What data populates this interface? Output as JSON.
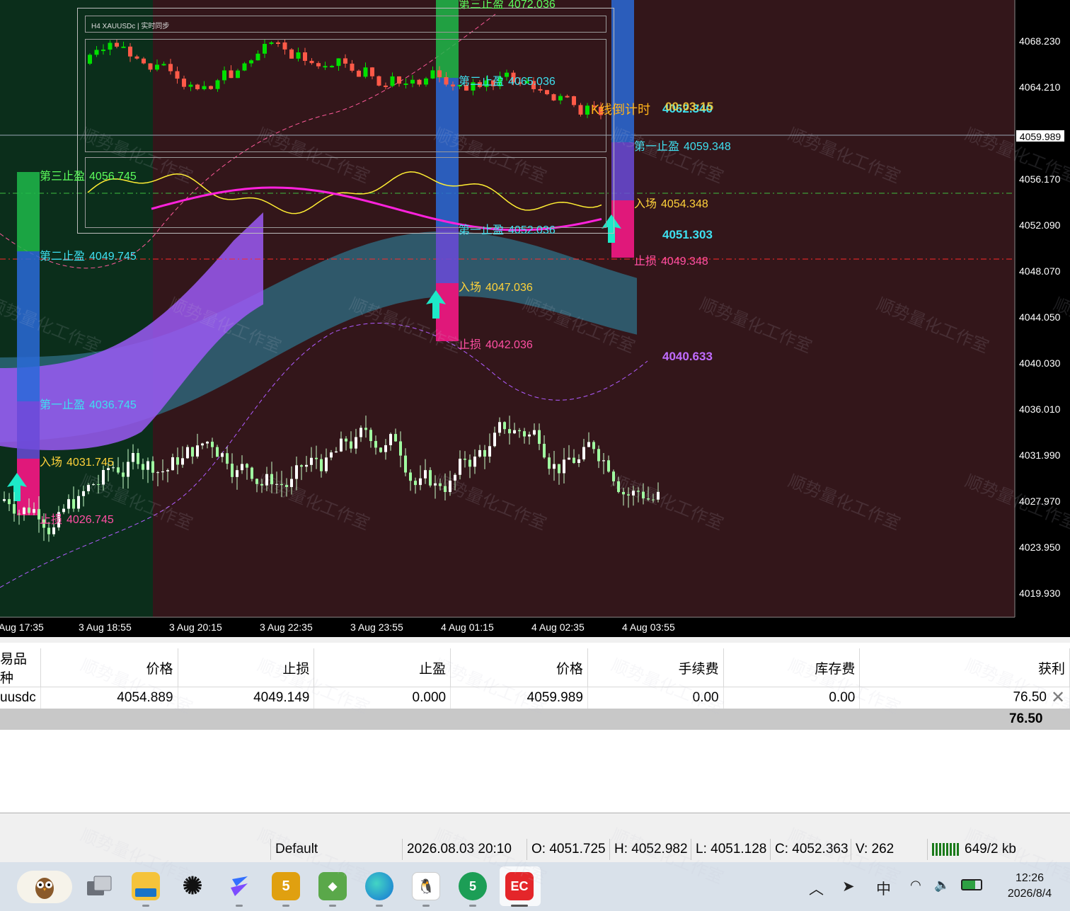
{
  "chart": {
    "mini_title": "H4  XAUUSDc  |  实时同步",
    "countdown_label": "K线倒计时",
    "countdown_value": "00:03:15",
    "overlap_price": "4062.340",
    "current_price": "4059.989",
    "price_axis": [
      "4068.230",
      "4064.210",
      "4056.170",
      "4052.090",
      "4048.070",
      "4044.050",
      "4040.030",
      "4036.010",
      "4031.990",
      "4027.970",
      "4023.950",
      "4019.930"
    ],
    "time_axis": [
      "Aug 17:35",
      "3 Aug 18:55",
      "3 Aug 20:15",
      "3 Aug 22:35",
      "3 Aug 23:55",
      "4 Aug 01:15",
      "4 Aug 02:35",
      "4 Aug 03:55"
    ],
    "signal_blocks": [
      {
        "tp3_label": "第三止盈",
        "tp3": "4056.745",
        "tp2_label": "第二止盈",
        "tp2": "4049.745",
        "tp1_label": "第一止盈",
        "tp1": "4036.745",
        "entry_label": "入场",
        "entry": "4031.745",
        "sl_label": "止损",
        "sl": "4026.745"
      },
      {
        "tp3_label": "第三止盈",
        "tp3": "4072.036",
        "tp2_label": "第二止盈",
        "tp2": "4065.036",
        "tp1_label": "第一止盈",
        "tp1": "4052.036",
        "entry_label": "入场",
        "entry": "4047.036",
        "sl_label": "止损",
        "sl": "4042.036"
      },
      {
        "tp1_label": "第一止盈",
        "tp1": "4059.348",
        "entry_label": "入场",
        "entry": "4054.348",
        "sl_label": "止损",
        "sl": "4049.348"
      }
    ],
    "band_upper": "4051.303",
    "band_lower": "4040.633",
    "watermark": "顺势量化工作室",
    "colors": {
      "background_dark": "#33161a",
      "green_zone": "#0b2e1b",
      "bull_candle": "#00e000",
      "bear_candle": "#ff5a48",
      "tp_text": "#3ee0f0",
      "entry_text": "#ffd23a",
      "sl_text": "#ff4fa3",
      "purple_band": "#9b59f5"
    }
  },
  "trades": {
    "headers": [
      "易品种",
      "价格",
      "止损",
      "止盈",
      "价格",
      "手续费",
      "库存费",
      "获利"
    ],
    "row": {
      "symbol": "uusdc",
      "open_price": "4054.889",
      "sl": "4049.149",
      "tp": "0.000",
      "price": "4059.989",
      "commission": "0.00",
      "swap": "0.00",
      "profit": "76.50"
    },
    "total_profit": "76.50"
  },
  "status": {
    "profile": "Default",
    "datetime": "2026.08.03 20:10",
    "open": "O: 4051.725",
    "high": "H: 4052.982",
    "low": "L: 4051.128",
    "close": "C: 4052.363",
    "volume": "V: 262",
    "traffic": "649/2 kb"
  },
  "taskbar": {
    "apps": [
      "owl-app",
      "task-view",
      "file-explorer",
      "chatgpt",
      "feishu",
      "app-5",
      "maps",
      "edge",
      "qq",
      "metatrader5",
      "ec-app"
    ],
    "ime": "中",
    "time": "12:26",
    "date": "2026/8/4"
  }
}
